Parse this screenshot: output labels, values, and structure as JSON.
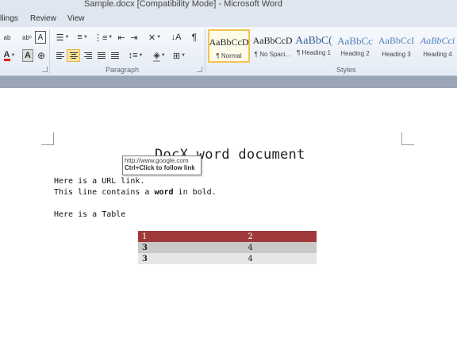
{
  "window": {
    "title": "Sample.docx [Compatibility Mode]  -  Microsoft Word"
  },
  "tabs": [
    "llings",
    "Review",
    "View"
  ],
  "ribbon": {
    "paragraph_label": "Paragraph",
    "styles_label": "Styles",
    "font_buttons_row1": [
      "abc",
      "ᵃᵇᶜ",
      "A"
    ],
    "styles": [
      {
        "sample": "AaBbCcDc",
        "name": "¶ Normal",
        "selected": true,
        "color": "#222222"
      },
      {
        "sample": "AaBbCcDc",
        "name": "¶ No Spaci...",
        "selected": false,
        "color": "#222222"
      },
      {
        "sample": "AaBbC(",
        "name": "¶ Heading 1",
        "selected": false,
        "color": "#365f91"
      },
      {
        "sample": "AaBbCc",
        "name": "Heading 2",
        "selected": false,
        "color": "#4f81bd"
      },
      {
        "sample": "AaBbCcI",
        "name": "Heading 3",
        "selected": false,
        "color": "#4f81bd"
      },
      {
        "sample": "AaBbCci",
        "name": "Heading 4",
        "selected": false,
        "color": "#4f81bd"
      }
    ]
  },
  "document": {
    "title": "DocX word document",
    "url_line": "Here is a URL link.",
    "bold_line_before": "This line contains a ",
    "bold_word": "word",
    "bold_line_after": " in bold.",
    "table_line": "Here is a Table",
    "table": {
      "header": [
        "1",
        "2"
      ],
      "rows": [
        [
          "3",
          "4"
        ],
        [
          "3",
          "4"
        ]
      ]
    }
  },
  "tooltip": {
    "url": "http://www.google.com",
    "hint": "Ctrl+Click to follow link"
  },
  "colors": {
    "table_header": "#9e3b3a",
    "accent_highlight": "#fbe39a"
  }
}
